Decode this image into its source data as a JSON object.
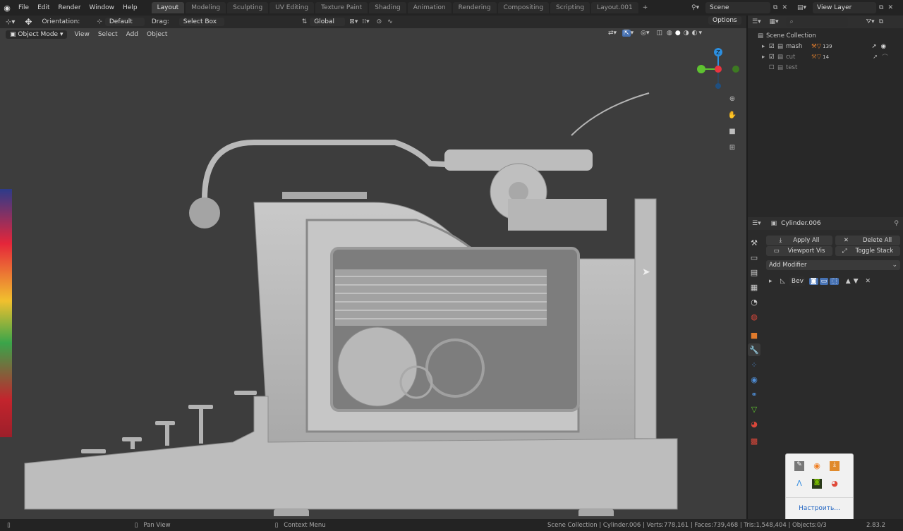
{
  "topbar": {
    "menus": [
      "File",
      "Edit",
      "Render",
      "Window",
      "Help"
    ],
    "workspaces": [
      "Layout",
      "Modeling",
      "Sculpting",
      "UV Editing",
      "Texture Paint",
      "Shading",
      "Animation",
      "Rendering",
      "Compositing",
      "Scripting",
      "Layout.001"
    ],
    "active_workspace": "Layout",
    "scene_label": "Scene",
    "view_layer_label": "View Layer"
  },
  "tool_header": {
    "orientation_label": "Orientation:",
    "orientation_value": "Default",
    "drag_label": "Drag:",
    "drag_value": "Select Box",
    "transform_value": "Global",
    "options_label": "Options"
  },
  "viewport_header": {
    "mode": "Object Mode",
    "view": "View",
    "select": "Select",
    "add": "Add",
    "object": "Object"
  },
  "gizmo": {
    "z": "Z",
    "x": "X",
    "y": "Y"
  },
  "outliner": {
    "root": "Scene Collection",
    "items": [
      {
        "name": "mash",
        "badge": "139"
      },
      {
        "name": "cut",
        "badge": "14"
      },
      {
        "name": "test",
        "badge": ""
      }
    ]
  },
  "properties": {
    "object_name": "Cylinder.006",
    "apply_all": "Apply All",
    "delete_all": "Delete All",
    "viewport_vis": "Viewport Vis",
    "toggle_stack": "Toggle Stack",
    "add_modifier": "Add Modifier",
    "modifier_name": "Bev"
  },
  "tray": {
    "configure_label": "Настроить..."
  },
  "statusbar": {
    "pan_view": "Pan View",
    "context_menu": "Context Menu",
    "stats": "Scene Collection | Cylinder.006 | Verts:778,161 | Faces:739,468 | Tris:1,548,404 | Objects:0/3",
    "version": "2.83.2"
  },
  "colors": {
    "accent_blue": "#4772b3",
    "axis_x": "#e8343f",
    "axis_y": "#5ec230",
    "axis_z": "#2c8fe0",
    "modifier_orange": "#e07b2c"
  }
}
